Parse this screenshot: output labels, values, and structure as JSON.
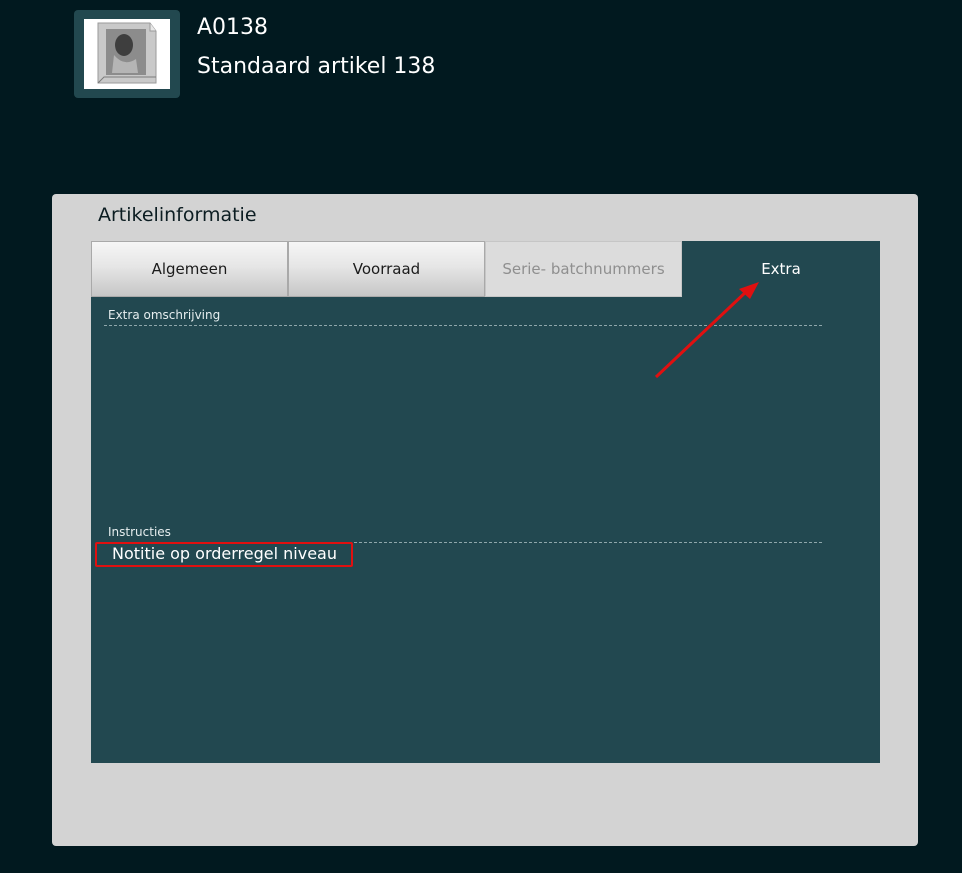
{
  "article": {
    "code": "A0138",
    "name": "Standaard artikel 138",
    "thumbnail": "article-image"
  },
  "panel": {
    "title": "Artikelinformatie",
    "tabs": [
      {
        "label": "Algemeen",
        "state": "normal"
      },
      {
        "label": "Voorraad",
        "state": "normal"
      },
      {
        "label": "Serie- batchnummers",
        "state": "disabled"
      },
      {
        "label": "Extra",
        "state": "active"
      }
    ],
    "extra_description": {
      "label": "Extra omschrijving",
      "value": ""
    },
    "instructions": {
      "label": "Instructies",
      "value": "Notitie op orderregel niveau"
    }
  },
  "colors": {
    "background": "#01191f",
    "panel": "#d3d3d3",
    "active_tab": "#224850",
    "annotation": "#e01010"
  }
}
